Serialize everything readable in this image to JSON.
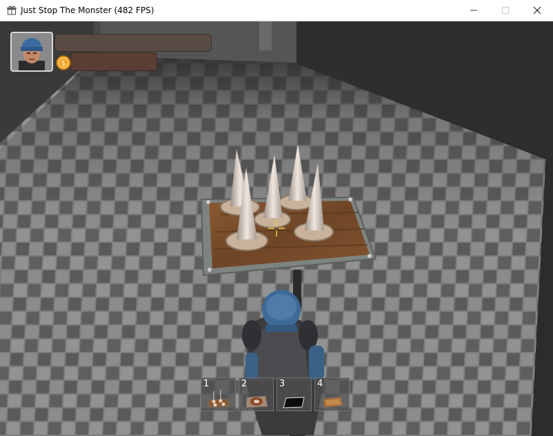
{
  "window": {
    "title": "Just Stop The Monster (482 FPS)",
    "icon": "gift-box-icon",
    "controls": [
      "minimize",
      "maximize",
      "close"
    ]
  },
  "hud": {
    "portrait": "soldier-portrait",
    "coin_icon": "coin-icon"
  },
  "hotbar": {
    "slots": [
      {
        "number": "1",
        "icon": "spike-trap-icon"
      },
      {
        "number": "2",
        "icon": "donut-trap-icon"
      },
      {
        "number": "3",
        "icon": "pit-trap-icon"
      },
      {
        "number": "4",
        "icon": "wood-floor-trap-icon"
      }
    ]
  },
  "colors": {
    "floor_light": "#8a8a8a",
    "floor_dark": "#505050",
    "wall": "#2a2a2a",
    "crosshair": "#e8d23a",
    "hud_bar": "#5a4a44"
  }
}
